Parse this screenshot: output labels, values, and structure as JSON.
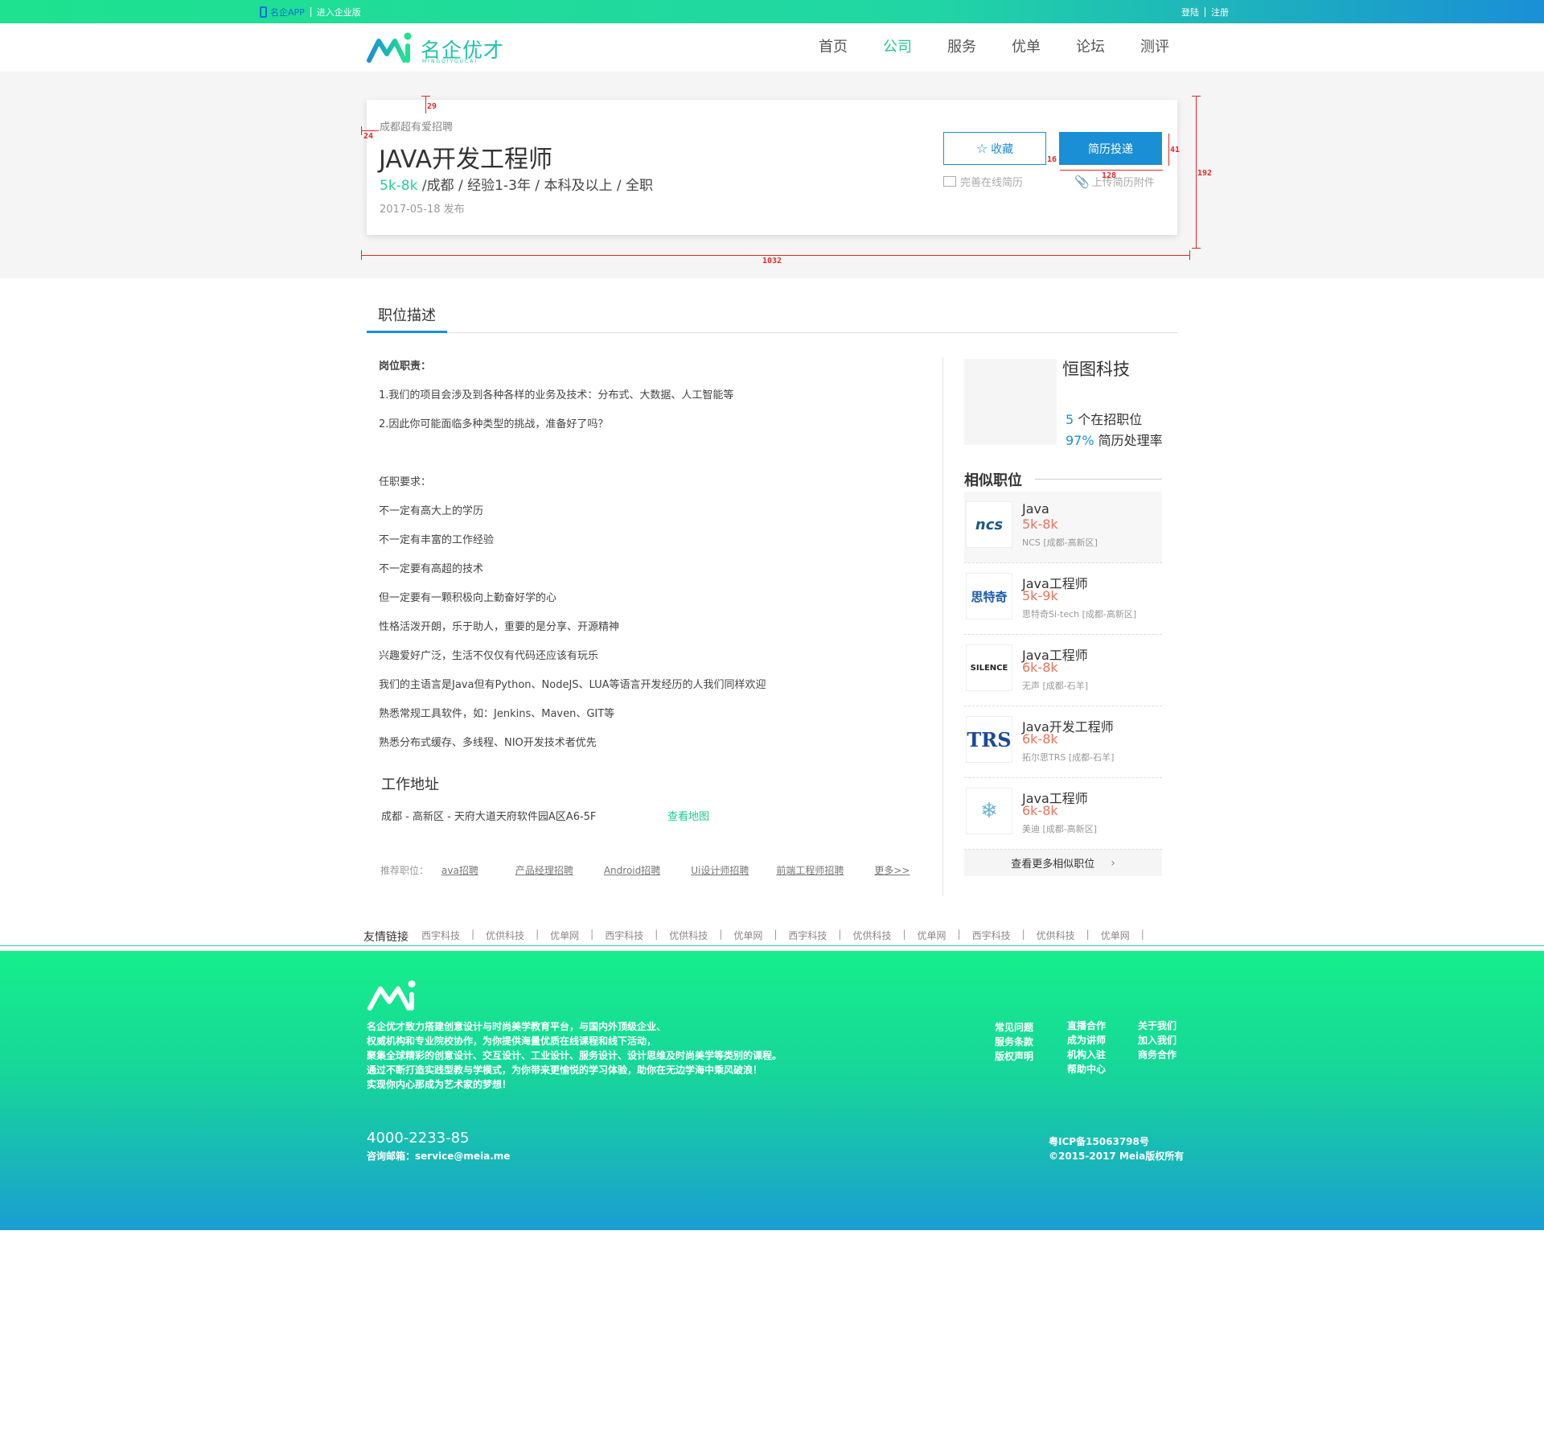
{
  "topbar": {
    "app_label": "名企APP",
    "enterprise_label": "进入企业版",
    "login": "登陆",
    "register": "注册"
  },
  "header": {
    "logo_name": "名企优才",
    "logo_sub": "MINGQIYOUCAI",
    "nav": [
      {
        "label": "首页"
      },
      {
        "label": "公司"
      },
      {
        "label": "服务"
      },
      {
        "label": "优单"
      },
      {
        "label": "论坛"
      },
      {
        "label": "测评"
      }
    ]
  },
  "job": {
    "company": "成都超有爱招聘",
    "title": "JAVA开发工程师",
    "salary": "5k-8k",
    "meta": "/成都 / 经验1-3年 / 本科及以上 / 全职",
    "date": "2017-05-18  发布",
    "favorite": "收藏",
    "apply": "简历投递",
    "complete_resume": "完善在线简历",
    "upload_attachment": "上传简历附件"
  },
  "annotations": [
    "29",
    "24",
    "16",
    "41",
    "128",
    "192",
    "1032"
  ],
  "tabs": {
    "description": "职位描述"
  },
  "description": {
    "lines": [
      "岗位职责：",
      "1.我们的项目会涉及到各种各样的业务及技术：分布式、大数据、人工智能等",
      "2.因此你可能面临多种类型的挑战，准备好了吗？",
      "任职要求：",
      "不一定有高大上的学历",
      "不一定有丰富的工作经验",
      "不一定要有高超的技术",
      "但一定要有一颗积极向上勤奋好学的心",
      "性格活泼开朗，乐于助人，重要的是分享、开源精神",
      "兴趣爱好广泛，生活不仅仅有代码还应该有玩乐",
      "我们的主语言是Java但有Python、NodeJS、LUA等语言开发经历的人我们同样欢迎",
      "熟悉常规工具软件，如：Jenkins、Maven、GIT等",
      "熟悉分布式缓存、多线程、NIO开发技术者优先"
    ]
  },
  "address": {
    "title": "工作地址",
    "text": "成都 - 高新区 - 天府大道天府软件园A区A6-5F",
    "map_link": "查看地图"
  },
  "recommend": {
    "label": "推荐职位：",
    "items": [
      "ava招聘",
      "产品经理招聘",
      "Android招聘",
      "Ui设计师招聘",
      "前端工程师招聘",
      "更多>>"
    ]
  },
  "company_card": {
    "name": "恒图科技",
    "jobs_count": "5",
    "jobs_label": "个在招职位",
    "rate": "97%",
    "rate_label": "简历处理率"
  },
  "similar": {
    "title": "相似职位",
    "items": [
      {
        "title": "Java",
        "salary": "5k-8k",
        "company": "NCS [成都-高新区]",
        "logo": "ncs"
      },
      {
        "title": "Java工程师",
        "salary": "5k-9k",
        "company": "思特奇Si-tech [成都-高新区]",
        "logo": "思特奇"
      },
      {
        "title": "Java工程师",
        "salary": "6k-8k",
        "company": "无声 [成都-石羊]",
        "logo": "SILENCE"
      },
      {
        "title": "Java开发工程师",
        "salary": "6k-8k",
        "company": "拓尔思TRS [成都-石羊]",
        "logo": "TRS"
      },
      {
        "title": "Java工程师",
        "salary": "6k-8k",
        "company": "美迪 [成都-高新区]",
        "logo": "snowflake"
      }
    ],
    "more": "查看更多相似职位"
  },
  "friends": {
    "label": "友情链接",
    "items": [
      "西宇科技",
      "优供科技",
      "优单网",
      "西宇科技",
      "优供科技",
      "优单网",
      "西宇科技",
      "优供科技",
      "优单网",
      "西宇科技",
      "优供科技",
      "优单网"
    ]
  },
  "footer": {
    "desc": [
      "名企优才致力搭建创意设计与时尚美学教育平台，与国内外顶级企业、",
      "权威机构和专业院校协作，为你提供海量优质在线课程和线下活动，",
      "聚集全球精彩的创意设计、交互设计、工业设计、服务设计、设计思维及时尚美学等类别的课程。",
      "通过不断打造实践型教与学模式，为你带来更愉悦的学习体验，助你在无边学海中乘风破浪！",
      "实现你内心那成为艺术家的梦想！"
    ],
    "phone": "4000-2233-85",
    "email": "咨询邮箱：service@meia.me",
    "col1": [
      "常见问题",
      "服务条款",
      "版权声明"
    ],
    "col2": [
      "直播合作",
      "成为讲师",
      "机构入驻",
      "帮助中心"
    ],
    "col3": [
      "关于我们",
      "加入我们",
      "商务合作"
    ],
    "icp": "粤ICP备15063798号",
    "copyright": "©2015-2017 Meia版权所有"
  },
  "colors": {
    "accent_green": "#1ecb8a",
    "accent_blue": "#1a8fd6",
    "salary_orange": "#e9735a",
    "annotation_red": "#e52727"
  }
}
